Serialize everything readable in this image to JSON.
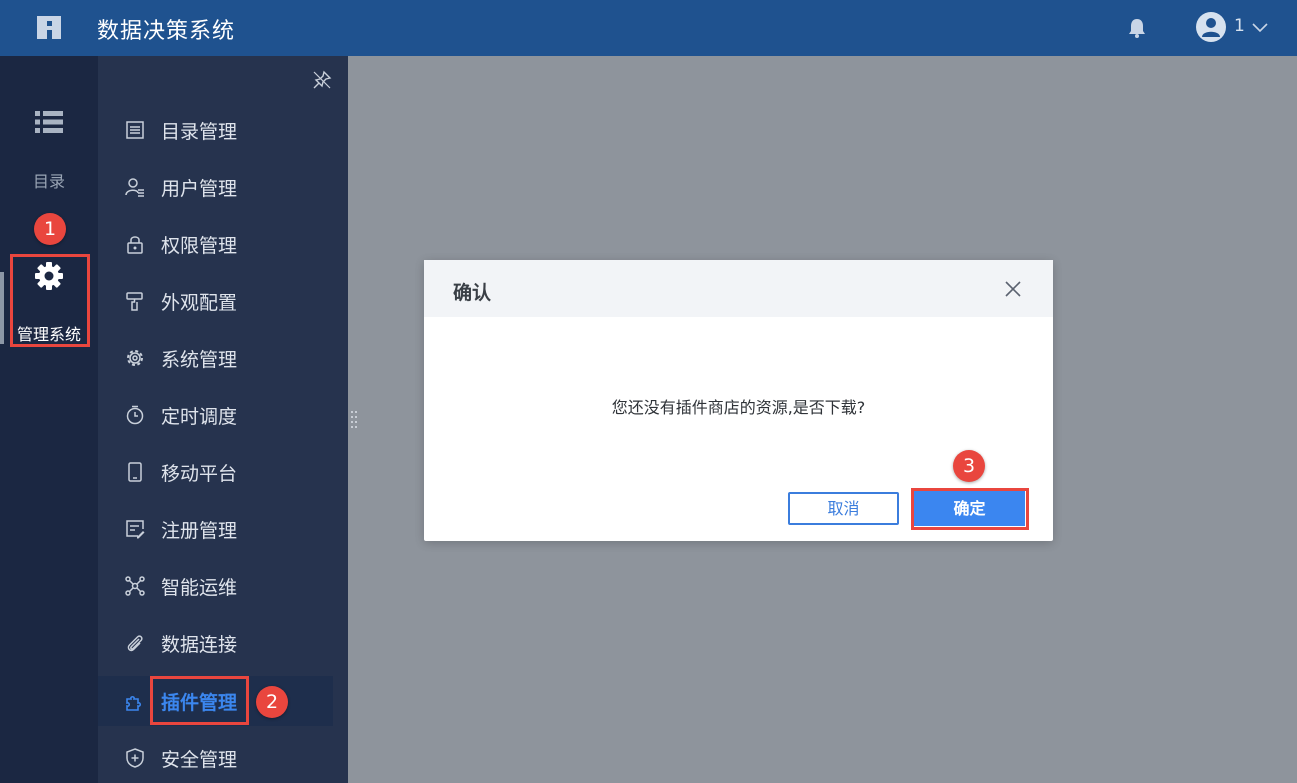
{
  "header": {
    "title": "数据决策系统",
    "user_name": "1"
  },
  "rail": {
    "catalog_label": "目录",
    "admin_label": "管理系统"
  },
  "menu": {
    "items": [
      {
        "label": "目录管理",
        "icon": "list-icon"
      },
      {
        "label": "用户管理",
        "icon": "user-icon"
      },
      {
        "label": "权限管理",
        "icon": "lock-icon"
      },
      {
        "label": "外观配置",
        "icon": "brush-icon"
      },
      {
        "label": "系统管理",
        "icon": "gear-icon"
      },
      {
        "label": "定时调度",
        "icon": "timer-icon"
      },
      {
        "label": "移动平台",
        "icon": "mobile-icon"
      },
      {
        "label": "注册管理",
        "icon": "register-icon"
      },
      {
        "label": "智能运维",
        "icon": "network-icon"
      },
      {
        "label": "数据连接",
        "icon": "paperclip-icon"
      },
      {
        "label": "插件管理",
        "icon": "puzzle-icon"
      },
      {
        "label": "安全管理",
        "icon": "shield-icon"
      }
    ],
    "active_index": 10
  },
  "badges": [
    "1",
    "2",
    "3"
  ],
  "dialog": {
    "title": "确认",
    "message": "您还没有插件商店的资源,是否下载?",
    "cancel_label": "取消",
    "ok_label": "确定"
  },
  "colors": {
    "header_bg": "#1f528f",
    "rail_bg": "#1b2742",
    "submenu_bg": "#26334e",
    "overlay": "#8e949c",
    "accent": "#3b86f0",
    "highlight": "#e9463e"
  }
}
